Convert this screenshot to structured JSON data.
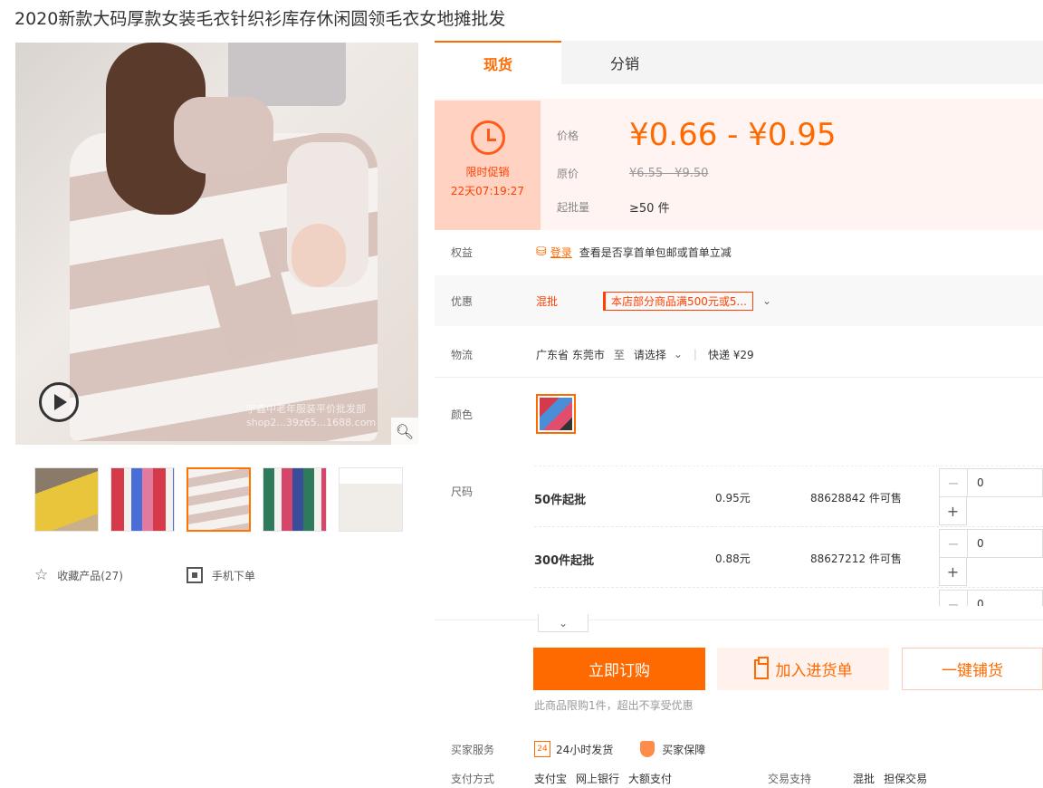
{
  "product_title": "2020新款大码厚款女装毛衣针织衫库存休闲圆领毛衣女地摊批发",
  "gallery": {
    "watermark_line1": "宇鑫中老年服装平价批发部",
    "watermark_line2": "shop2...39z65...1688.com"
  },
  "left_actions": {
    "favorite_label": "收藏产品(27)",
    "mobile_label": "手机下单"
  },
  "tabs": [
    "现货",
    "分销"
  ],
  "promo": {
    "label": "限时促销",
    "countdown": "22天07:19:27"
  },
  "price": {
    "price_label": "价格",
    "price_range": "¥0.66 - ¥0.95",
    "original_label": "原价",
    "original_range": "¥6.55 - ¥9.50",
    "moq_label": "起批量",
    "moq_value": "≥50 件"
  },
  "rights": {
    "label": "权益",
    "login": "登录",
    "text": "查看是否享首单包邮或首单立减"
  },
  "discount": {
    "label": "优惠",
    "tag": "混批",
    "coupon": "本店部分商品满500元或5..."
  },
  "logistics": {
    "label": "物流",
    "from": "广东省 东莞市",
    "to_label": "至",
    "to": "请选择",
    "express": "快递 ¥29"
  },
  "color_label": "颜色",
  "size_label": "尺码",
  "sizes": [
    {
      "name": "50件起批",
      "price": "0.95元",
      "stock": "88628842 件可售",
      "qty": "0"
    },
    {
      "name": "300件起批",
      "price": "0.88元",
      "stock": "88627212 件可售",
      "qty": "0"
    },
    {
      "name": "",
      "price": "",
      "stock": "",
      "qty": "0"
    }
  ],
  "buttons": {
    "buy": "立即订购",
    "cart": "加入进货单",
    "dropship": "一键铺货"
  },
  "limit_note": "此商品限购1件，超出不享受优惠",
  "services": {
    "label": "买家服务",
    "badge": "24",
    "ship": "24小时发货",
    "guarantee": "买家保障"
  },
  "payment": {
    "label": "支付方式",
    "methods": [
      "支付宝",
      "网上银行",
      "大额支付"
    ],
    "trade_label": "交易支持",
    "trade_methods": [
      "混批",
      "担保交易"
    ]
  },
  "colors": {
    "accent": "#ff6a00",
    "promo_bg": "#ffd2c2",
    "price_bg": "#fff4f2"
  }
}
